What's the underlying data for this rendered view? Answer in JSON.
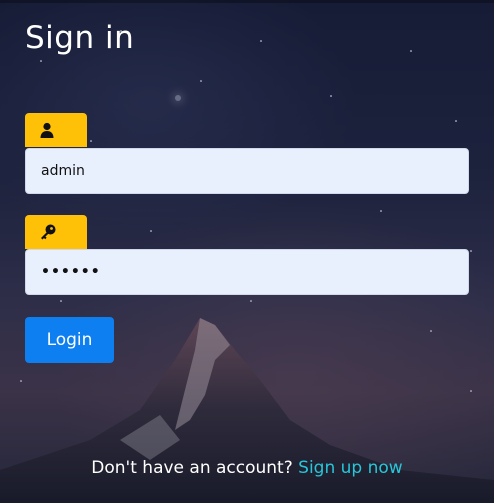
{
  "page": {
    "title": "Sign in"
  },
  "username": {
    "icon": "user-icon",
    "value": "admin"
  },
  "password": {
    "icon": "key-icon",
    "value": "••••••"
  },
  "actions": {
    "login_label": "Login"
  },
  "footer": {
    "prompt": "Don't have an account?",
    "signup_link": "Sign up now"
  },
  "colors": {
    "accent_primary": "#0d7ff0",
    "icon_tag": "#ffc107",
    "link": "#27c6d9",
    "field_bg": "#e8f0fe"
  }
}
